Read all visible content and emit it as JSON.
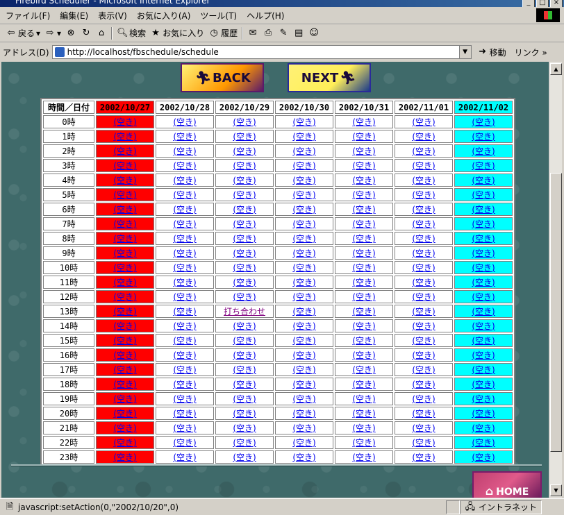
{
  "window": {
    "title": "Firebird Scheduler - Microsoft Internet Explorer",
    "controls": [
      "_",
      "□",
      "×"
    ]
  },
  "menu": {
    "items": [
      "ファイル(F)",
      "編集(E)",
      "表示(V)",
      "お気に入り(A)",
      "ツール(T)",
      "ヘルプ(H)"
    ]
  },
  "toolbar": {
    "back": "戻る",
    "search": "検索",
    "favorites": "お気に入り",
    "history": "履歴"
  },
  "address": {
    "label": "アドレス(D)",
    "url": "http://localhost/fbschedule/schedule",
    "go": "移動",
    "links": "リンク »"
  },
  "nav": {
    "back_label": "BACK",
    "next_label": "NEXT",
    "home_label": "HOME"
  },
  "schedule": {
    "corner": "時間／日付",
    "dates": [
      "2002/10/27",
      "2002/10/28",
      "2002/10/29",
      "2002/10/30",
      "2002/10/31",
      "2002/11/01",
      "2002/11/02"
    ],
    "date_colors": [
      "#ff0000",
      "#ffffff",
      "#ffffff",
      "#ffffff",
      "#ffffff",
      "#ffffff",
      "#00ffff"
    ],
    "hours": [
      "0時",
      "1時",
      "2時",
      "3時",
      "4時",
      "5時",
      "6時",
      "7時",
      "8時",
      "9時",
      "10時",
      "11時",
      "12時",
      "13時",
      "14時",
      "15時",
      "16時",
      "17時",
      "18時",
      "19時",
      "20時",
      "21時",
      "22時",
      "23時"
    ],
    "empty_label": "(空き)",
    "booked": {
      "row": 13,
      "col": 2,
      "label": "打ち合わせ"
    }
  },
  "status": {
    "message": "javascript:setAction(0,\"2002/10/20\",0)",
    "zone": "イントラネット"
  }
}
